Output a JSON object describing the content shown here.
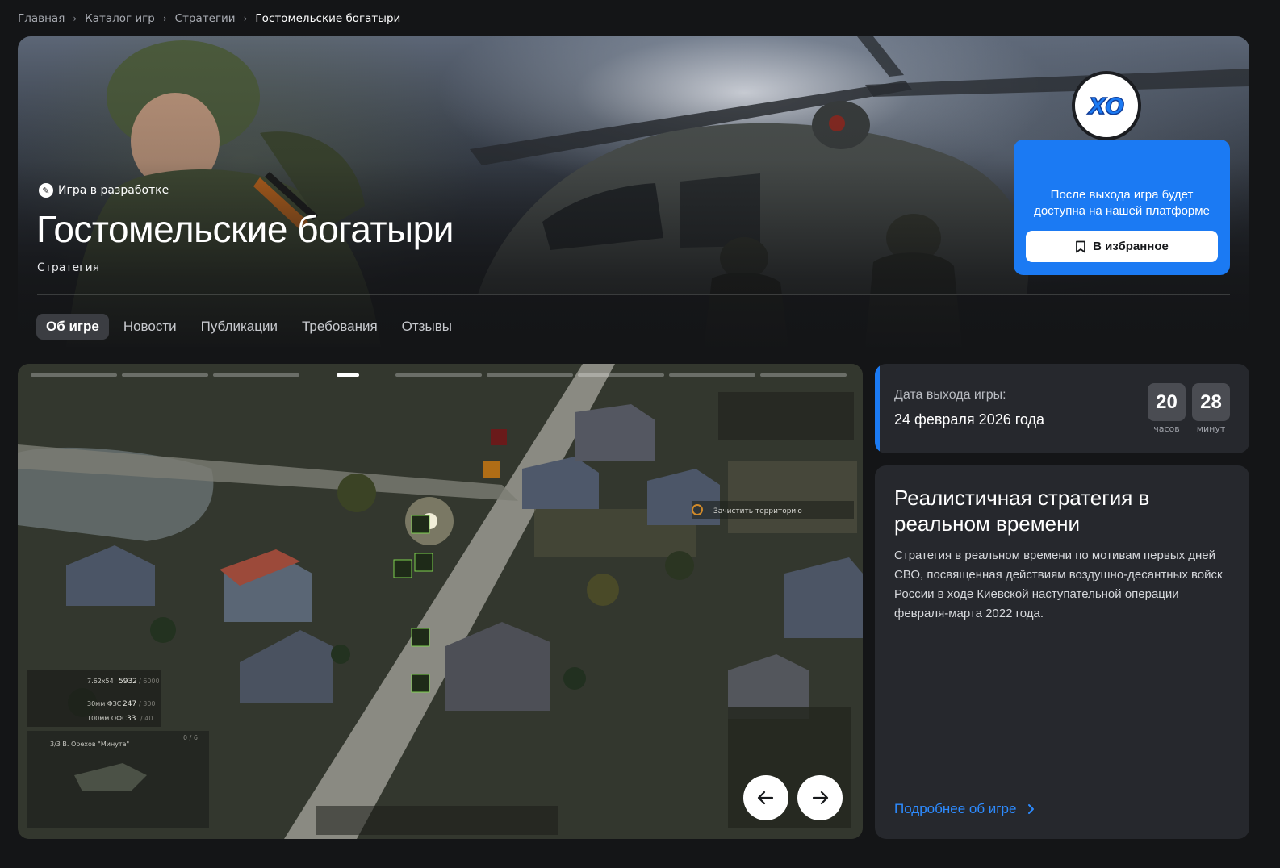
{
  "breadcrumbs": [
    {
      "label": "Главная"
    },
    {
      "label": "Каталог игр"
    },
    {
      "label": "Стратегии"
    },
    {
      "label": "Гостомельские богатыри"
    }
  ],
  "hero": {
    "badge": "Игра в разработке",
    "title": "Гостомельские богатыри",
    "genre": "Стратегия"
  },
  "tabs": [
    {
      "label": "Об игре",
      "active": true
    },
    {
      "label": "Новости"
    },
    {
      "label": "Публикации"
    },
    {
      "label": "Требования"
    },
    {
      "label": "Отзывы"
    }
  ],
  "release": {
    "logo_text": "XO",
    "text": "После выхода игра будет доступна на нашей платформе",
    "button": "В избранное"
  },
  "gallery": {
    "slide_count": 9,
    "active_slide": 4,
    "overlay_text": "Зачистить территорию",
    "hud": {
      "ammo": [
        {
          "name": "7.62x54",
          "count": "5932",
          "max": "/ 6000"
        },
        {
          "name": "30мм ФЗС",
          "count": "247",
          "max": "/ 300"
        },
        {
          "name": "100мм ОФС",
          "count": "33",
          "max": "/ 40"
        }
      ],
      "unit_name": "3/3 В. Орехов \"Минута\"",
      "unit_count": "0 / 6"
    },
    "prev_label": "previous-slide",
    "next_label": "next-slide"
  },
  "release_date": {
    "label": "Дата выхода игры:",
    "value": "24 февраля 2026 года",
    "hours": "20",
    "hours_label": "часов",
    "minutes": "28",
    "minutes_label": "минут"
  },
  "about": {
    "title": "Реалистичная стратегия в реальном времени",
    "description": "Стратегия в реальном времени по мотивам первых дней СВО, посвященная действиям воздушно-десантных войск России в ходе Киевской наступательной операции февраля-марта 2022 года.",
    "more_link": "Подробнее об игре"
  },
  "colors": {
    "accent": "#1b7af3",
    "link": "#2d8bff",
    "card": "#26282d",
    "background": "#141517"
  }
}
